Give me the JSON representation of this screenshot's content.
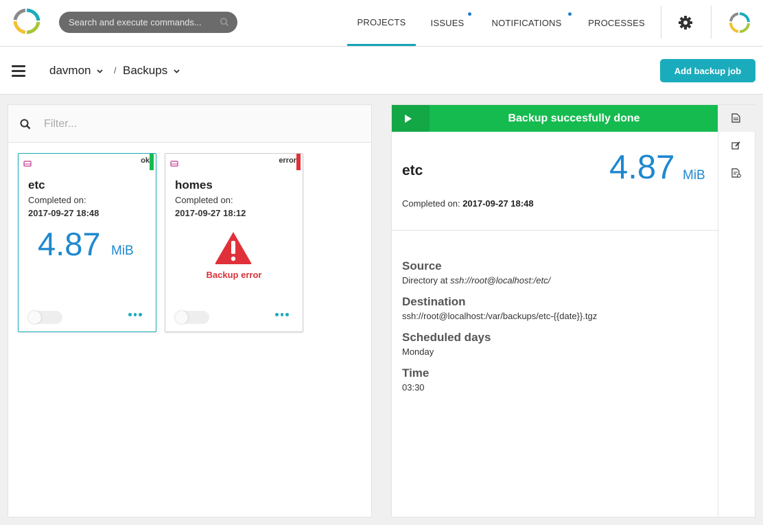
{
  "search": {
    "placeholder": "Search and execute commands..."
  },
  "nav": {
    "items": [
      {
        "label": "PROJECTS",
        "active": true,
        "dot": false
      },
      {
        "label": "ISSUES",
        "active": false,
        "dot": true
      },
      {
        "label": "NOTIFICATIONS",
        "active": false,
        "dot": true
      },
      {
        "label": "PROCESSES",
        "active": false,
        "dot": false
      }
    ]
  },
  "breadcrumb": {
    "project": "davmon",
    "separator": "/",
    "section": "Backups"
  },
  "toolbar": {
    "add_label": "Add backup job"
  },
  "filter": {
    "placeholder": "Filter..."
  },
  "jobs": [
    {
      "name": "etc",
      "status": "ok",
      "status_color": "#16bb4f",
      "completed_label": "Completed on:",
      "completed_at": "2017-09-27 18:48",
      "size": "4.87",
      "unit": "MiB"
    },
    {
      "name": "homes",
      "status": "error",
      "status_color": "#e0313a",
      "completed_label": "Completed on:",
      "completed_at": "2017-09-27 18:12",
      "error_text": "Backup error"
    }
  ],
  "detail": {
    "banner": "Backup succesfully done",
    "name": "etc",
    "size": "4.87",
    "unit": "MiB",
    "completed_label": "Completed on:",
    "completed_at": "2017-09-27 18:48",
    "source_label": "Source",
    "source_prefix": "Directory at",
    "source_value": "ssh://root@localhost:/etc/",
    "destination_label": "Destination",
    "destination_value": "ssh://root@localhost:/var/backups/etc-{{date}}.tgz",
    "days_label": "Scheduled days",
    "days_value": "Monday",
    "time_label": "Time",
    "time_value": "03:30"
  },
  "colors": {
    "accent": "#1aacbc",
    "ok": "#16bb4f",
    "error": "#e0313a",
    "size": "#1e88cf"
  },
  "icons": [
    "app-logo-icon",
    "search-icon",
    "gear-icon",
    "user-avatar-icon",
    "hamburger-icon",
    "chevron-down-icon",
    "disk-icon",
    "warning-icon",
    "play-icon",
    "document-icon",
    "edit-icon",
    "log-icon"
  ]
}
